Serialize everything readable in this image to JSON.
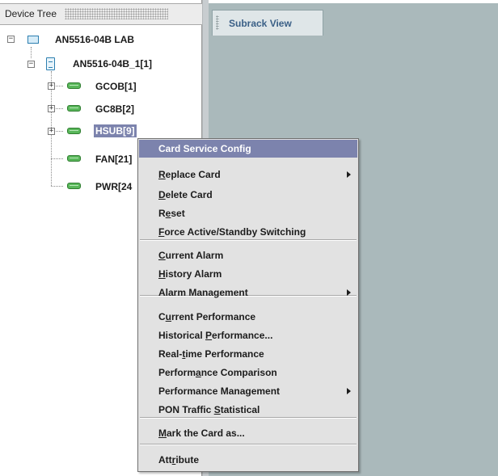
{
  "tree": {
    "title": "Device Tree",
    "nodes": [
      {
        "label": "AN5516-04B LAB",
        "expander": "−",
        "icon": "rack-icon"
      },
      {
        "label": "AN5516-04B_1[1]",
        "expander": "−",
        "icon": "shelf-icon"
      },
      {
        "label": "GCOB[1]",
        "expander": "+",
        "icon": "card-icon"
      },
      {
        "label": "GC8B[2]",
        "expander": "+",
        "icon": "card-icon"
      },
      {
        "label": "HSUB[9]",
        "expander": "+",
        "icon": "card-icon",
        "selected": true
      },
      {
        "label": "FAN[21]",
        "icon": "card-icon"
      },
      {
        "label": "PWR[24",
        "icon": "card-icon"
      }
    ]
  },
  "view": {
    "tab_label": "Subrack View"
  },
  "menu": {
    "items": [
      {
        "pre": "",
        "mn": "",
        "post": "Card Service Config",
        "highlighted": true
      },
      {
        "pre": "",
        "mn": "R",
        "post": "eplace Card",
        "submenu": true
      },
      {
        "pre": "",
        "mn": "D",
        "post": "elete Card"
      },
      {
        "pre": "R",
        "mn": "e",
        "post": "set"
      },
      {
        "pre": "",
        "mn": "F",
        "post": "orce Active/Standby Switching"
      },
      {
        "pre": "",
        "mn": "C",
        "post": "urrent Alarm"
      },
      {
        "pre": "",
        "mn": "H",
        "post": "istory Alarm"
      },
      {
        "pre": "",
        "mn": "",
        "post": "Alarm Management",
        "submenu": true
      },
      {
        "pre": "C",
        "mn": "u",
        "post": "rrent Performance"
      },
      {
        "pre": "Historical ",
        "mn": "P",
        "post": "erformance..."
      },
      {
        "pre": "Real-",
        "mn": "t",
        "post": "ime Performance"
      },
      {
        "pre": "Perform",
        "mn": "a",
        "post": "nce Comparison"
      },
      {
        "pre": "",
        "mn": "",
        "post": "Performance Management",
        "submenu": true
      },
      {
        "pre": "PON Traffic ",
        "mn": "S",
        "post": "tatistical"
      },
      {
        "pre": "",
        "mn": "M",
        "post": "ark the Card as..."
      },
      {
        "pre": "Att",
        "mn": "r",
        "post": "ibute"
      }
    ]
  },
  "colors": {
    "selection": "#7c83ad",
    "view_background": "#aab9bb",
    "menu_background": "#e2e2e2",
    "tab_text": "#3a5f86",
    "card_icon": "#59b75a"
  }
}
